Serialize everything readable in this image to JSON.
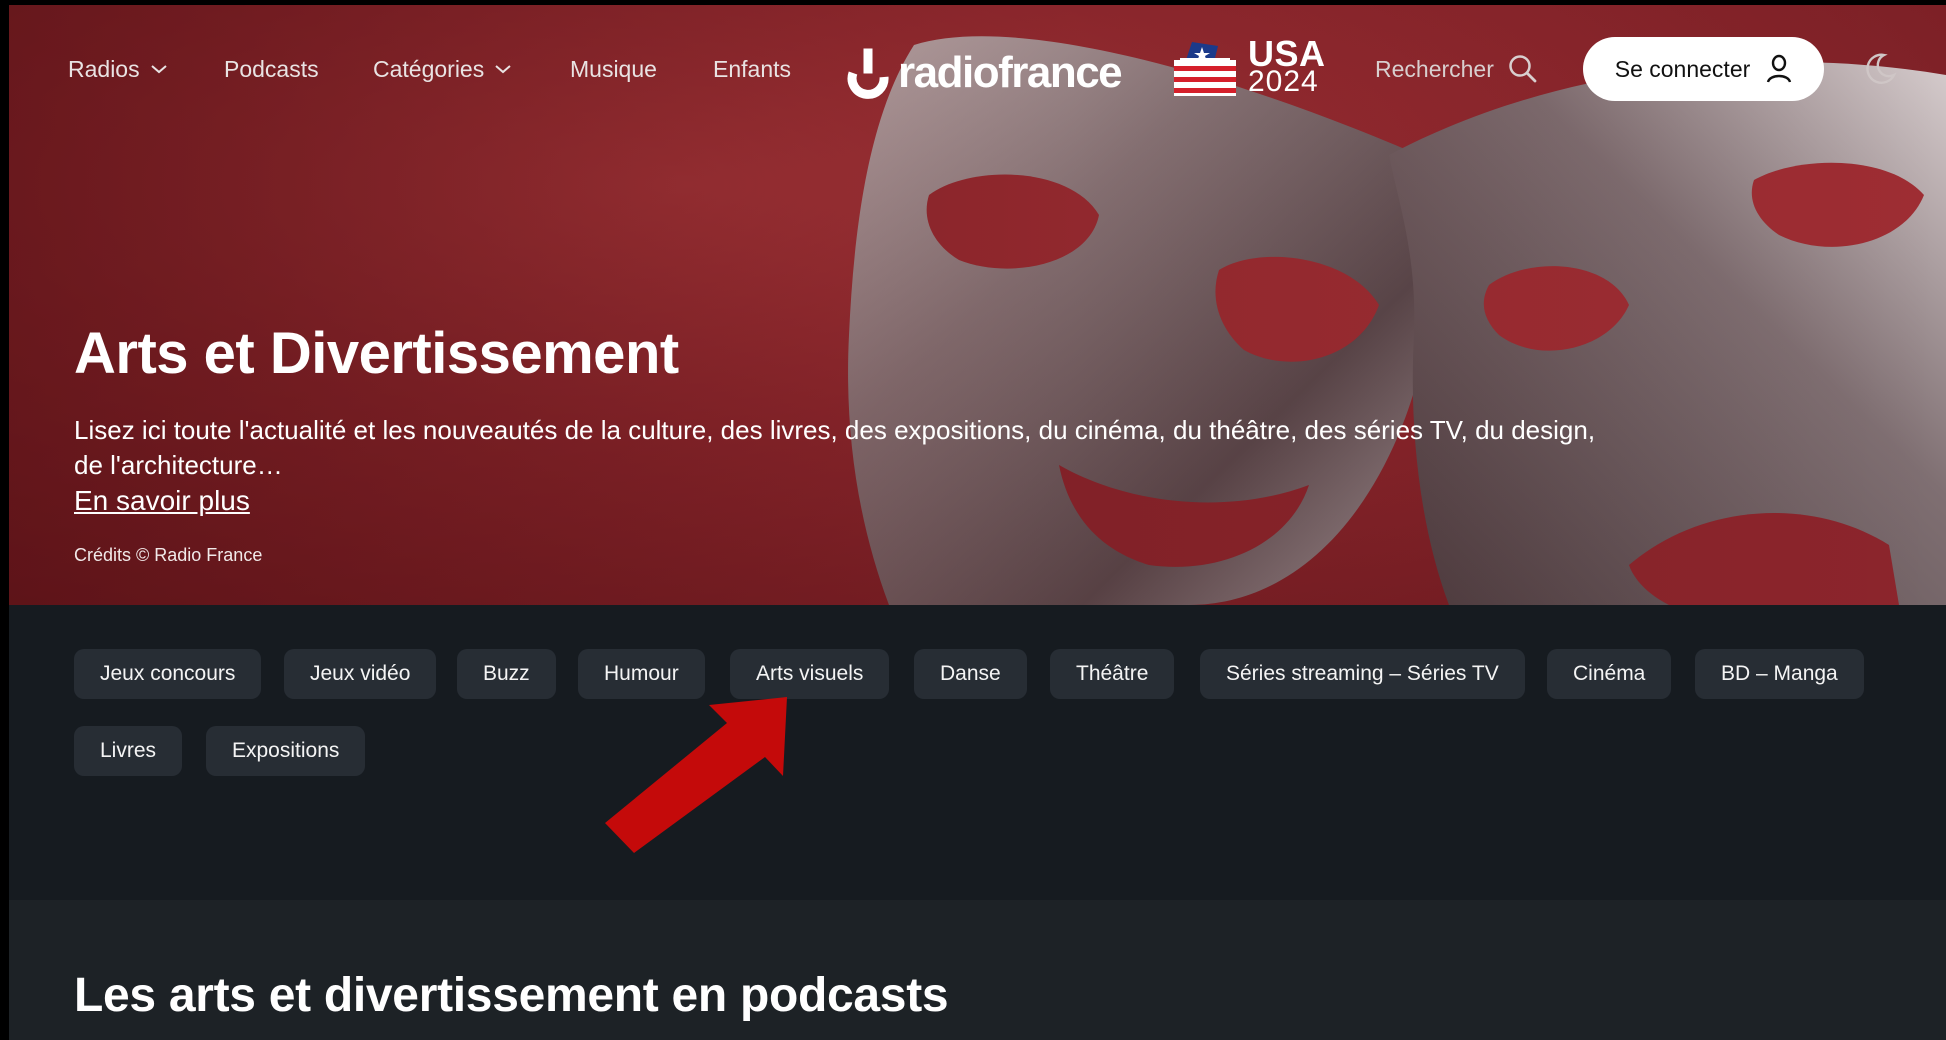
{
  "nav": {
    "radios": "Radios",
    "podcasts": "Podcasts",
    "categories": "Catégories",
    "music": "Musique",
    "kids": "Enfants",
    "logo_text": "radiofrance",
    "usa_title": "USA",
    "usa_year": "2024",
    "search_label": "Rechercher",
    "login_label": "Se connecter"
  },
  "hero": {
    "title": "Arts et Divertissement",
    "description": "Lisez ici toute l'actualité et les nouveautés de la culture, des livres, des expositions, du cinéma, du théâtre, des séries TV, du design, de l'architecture…",
    "more_link": "En savoir plus",
    "credits": "Crédits © Radio France"
  },
  "tags": [
    "Jeux concours",
    "Jeux vidéo",
    "Buzz",
    "Humour",
    "Arts visuels",
    "Danse",
    "Théâtre",
    "Séries streaming – Séries TV",
    "Cinéma",
    "BD – Manga",
    "Livres",
    "Expositions"
  ],
  "section": {
    "title": "Les arts et divertissement en podcasts"
  },
  "colors": {
    "hero_red": "#942a30",
    "dark_bg": "#161b20",
    "tag_bg": "#272d34",
    "arrow_red": "#c40a0a"
  }
}
